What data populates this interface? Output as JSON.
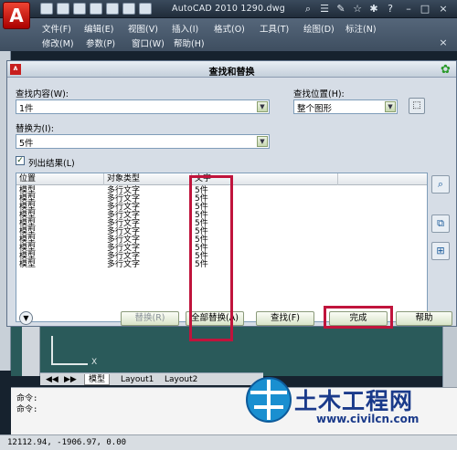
{
  "app": {
    "title": "AutoCAD 2010    1290.dwg",
    "logo": "A",
    "menus_row1": [
      "文件(F)",
      "编辑(E)",
      "视图(V)",
      "插入(I)",
      "格式(O)",
      "工具(T)",
      "绘图(D)",
      "标注(N)"
    ],
    "menus_row2": [
      "修改(M)",
      "参数(P)",
      "窗口(W)",
      "帮助(H)"
    ]
  },
  "dialog": {
    "title": "查找和替换",
    "logo": "A",
    "find_label": "查找内容(W):",
    "find_value": "1件",
    "location_label": "查找位置(H):",
    "location_value": "整个图形",
    "replace_label": "替换为(I):",
    "replace_value": "5件",
    "list_results_label": "列出结果(L)",
    "list_results_checked": true,
    "columns": [
      "位置",
      "对象类型",
      "文字"
    ],
    "rows": [
      [
        "模型",
        "多行文字",
        "5件"
      ],
      [
        "模型",
        "多行文字",
        "5件"
      ],
      [
        "模型",
        "多行文字",
        "5件"
      ],
      [
        "模型",
        "多行文字",
        "5件"
      ],
      [
        "模型",
        "多行文字",
        "5件"
      ],
      [
        "模型",
        "多行文字",
        "5件"
      ],
      [
        "模型",
        "多行文字",
        "5件"
      ],
      [
        "模型",
        "多行文字",
        "5件"
      ],
      [
        "模型",
        "多行文字",
        "5件"
      ],
      [
        "模型",
        "多行文字",
        "5件"
      ]
    ],
    "buttons": {
      "replace": "替换(R)",
      "replace_all": "全部替换(A)",
      "find": "查找(F)",
      "done": "完成",
      "help": "帮助"
    },
    "highlight_color": "#c0143c"
  },
  "drawing": {
    "axis_label": "X",
    "tabs": [
      "模型",
      "Layout1",
      "Layout2"
    ]
  },
  "command": {
    "line1": "命令:",
    "line2": "命令:"
  },
  "status": {
    "coordinates": "12112.94, -1906.97, 0.00"
  },
  "watermark": {
    "text": "土木工程网",
    "url": "www.civilcn.com"
  }
}
